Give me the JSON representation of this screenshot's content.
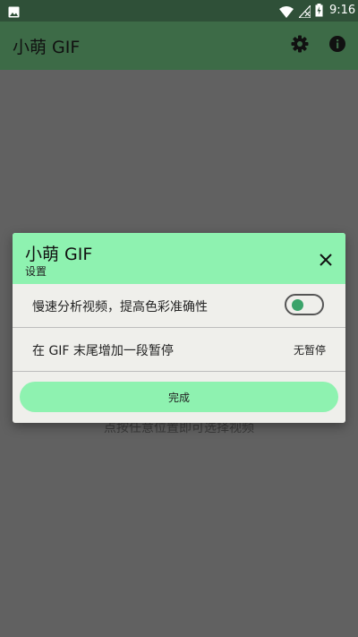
{
  "status_bar": {
    "time": "9:16",
    "icons": [
      "image-icon",
      "wifi-icon",
      "no-signal-icon",
      "battery-charging-icon"
    ]
  },
  "app_bar": {
    "title": "小萌 GIF",
    "actions": [
      "settings-icon",
      "info-icon"
    ]
  },
  "main": {
    "hint": "点按任意位置即可选择视频"
  },
  "dialog": {
    "title": "小萌 GIF",
    "subtitle": "设置",
    "close_icon": "close-icon",
    "options": [
      {
        "label": "慢速分析视频，提高色彩准确性",
        "control": "toggle",
        "enabled": true
      },
      {
        "label": "在 GIF 末尾增加一段暂停",
        "value": "无暂停"
      }
    ],
    "done_label": "完成"
  },
  "colors": {
    "status_bar_bg": "#2f5038",
    "app_bar_bg": "#3d6b47",
    "scrim_bg": "#616161",
    "dialog_header_bg": "#8ef2b0",
    "dialog_body_bg": "#efefeb",
    "toggle_knob": "#3aa36a"
  }
}
